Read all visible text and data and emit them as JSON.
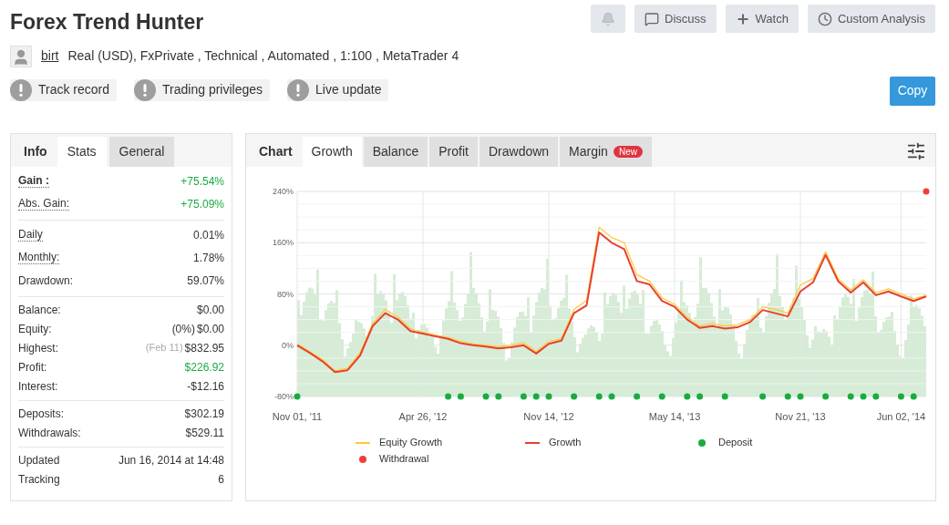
{
  "header": {
    "title": "Forex Trend Hunter",
    "actions": [
      {
        "kind": "bell"
      },
      {
        "kind": "discuss",
        "label": "Discuss"
      },
      {
        "kind": "watch",
        "label": "Watch"
      },
      {
        "kind": "clock",
        "label": "Custom Analysis"
      }
    ]
  },
  "account": {
    "author": "birt",
    "details": "Real (USD), FxPrivate , Technical , Automated , 1:100 , MetaTrader 4"
  },
  "badges": [
    "Track record",
    "Trading privileges",
    "Live update"
  ],
  "copy_button": "Copy",
  "stats_panel": {
    "title": "Info",
    "tabs": [
      {
        "label": "Stats",
        "selected": true
      },
      {
        "label": "General",
        "selected": false
      }
    ],
    "groups": [
      {
        "rows": [
          {
            "label": "Gain :",
            "value": "+75.54%",
            "bold": true,
            "dotted": true,
            "positive": true
          },
          {
            "label": "Abs. Gain:",
            "value": "+75.09%",
            "bold": false,
            "dotted": true,
            "positive": true
          }
        ]
      },
      {
        "rows": [
          {
            "label": "Daily",
            "value": "0.01%",
            "bold": false,
            "dotted": true,
            "positive": false
          },
          {
            "label": "Monthly:",
            "value": "1.78%",
            "bold": false,
            "dotted": true,
            "positive": false
          },
          {
            "label": "Drawdown:",
            "value": "59.07%",
            "bold": false,
            "dotted": false,
            "positive": false
          }
        ]
      },
      {
        "rows": [
          {
            "label": "Balance:",
            "value": "$0.00",
            "bold": false,
            "dotted": false,
            "positive": false
          },
          {
            "label": "Equity:",
            "note": "(0%)",
            "note_muted": false,
            "value": "$0.00",
            "bold": false,
            "dotted": false,
            "positive": false
          },
          {
            "label": "Highest:",
            "note": "(Feb 11)",
            "note_muted": true,
            "value": "$832.95",
            "bold": false,
            "dotted": false,
            "positive": false
          },
          {
            "label": "Profit:",
            "value": "$226.92",
            "bold": false,
            "dotted": false,
            "positive": true
          },
          {
            "label": "Interest:",
            "value": "-$12.16",
            "bold": false,
            "dotted": false,
            "positive": false
          }
        ]
      },
      {
        "rows": [
          {
            "label": "Deposits:",
            "value": "$302.19",
            "bold": false,
            "dotted": false,
            "positive": false
          },
          {
            "label": "Withdrawals:",
            "value": "$529.11",
            "bold": false,
            "dotted": false,
            "positive": false
          }
        ]
      },
      {
        "rows": [
          {
            "label": "Updated",
            "value": "Jun 16, 2014 at 14:48",
            "bold": false,
            "dotted": false,
            "positive": false
          },
          {
            "label": "Tracking",
            "value": "6",
            "bold": false,
            "dotted": false,
            "positive": false
          }
        ]
      }
    ]
  },
  "chart_panel": {
    "title": "Chart",
    "tabs": [
      {
        "label": "Growth",
        "selected": true
      },
      {
        "label": "Balance",
        "selected": false
      },
      {
        "label": "Profit",
        "selected": false
      },
      {
        "label": "Drawdown",
        "selected": false
      },
      {
        "label": "Margin",
        "selected": false,
        "badge": "New"
      }
    ],
    "chart_data": {
      "type": "line",
      "categories": [
        "Nov 01, '11",
        null,
        null,
        null,
        null,
        null,
        null,
        null,
        null,
        null,
        "Apr 26, '12",
        null,
        null,
        null,
        null,
        null,
        null,
        null,
        null,
        null,
        "Nov 14, '12",
        null,
        null,
        null,
        null,
        null,
        null,
        null,
        null,
        null,
        "May 14, '13",
        null,
        null,
        null,
        null,
        null,
        null,
        null,
        null,
        null,
        "Nov 21, '13",
        null,
        null,
        null,
        null,
        null,
        null,
        null,
        "Jun 02, '14",
        null,
        null
      ],
      "ylim": [
        -80,
        240
      ],
      "grid": true,
      "yticks": [
        {
          "value": 240,
          "label": "240%"
        },
        {
          "value": 160,
          "label": "160%"
        },
        {
          "value": 80,
          "label": "80%"
        },
        {
          "value": 0,
          "label": "0%"
        },
        {
          "value": -80,
          "label": "-80%"
        }
      ],
      "series": [
        {
          "name": "Equity Growth",
          "color": "#ffc933",
          "values": [
            2,
            -10,
            -22,
            -40,
            -36,
            -12,
            34,
            56,
            44,
            26,
            20,
            16,
            12,
            6,
            2,
            0,
            -2,
            0,
            4,
            -10,
            6,
            10,
            56,
            70,
            184,
            168,
            160,
            110,
            100,
            74,
            64,
            44,
            30,
            34,
            30,
            32,
            40,
            60,
            56,
            50,
            94,
            104,
            146,
            104,
            86,
            102,
            82,
            88,
            80,
            72,
            78
          ]
        },
        {
          "name": "Growth",
          "color": "#e8402f",
          "values": [
            0,
            -12,
            -25,
            -42,
            -39,
            -16,
            30,
            50,
            40,
            22,
            18,
            14,
            10,
            3,
            0,
            -2,
            -5,
            -3,
            0,
            -13,
            2,
            7,
            50,
            62,
            176,
            160,
            150,
            100,
            95,
            69,
            60,
            40,
            27,
            30,
            26,
            28,
            36,
            55,
            50,
            45,
            84,
            98,
            141,
            100,
            82,
            98,
            78,
            84,
            76,
            69,
            76
          ]
        },
        {
          "name": "Deposit",
          "type": "scatter",
          "color": "#1aab40",
          "values": [
            -80,
            null,
            null,
            null,
            null,
            null,
            null,
            null,
            null,
            null,
            null,
            null,
            -80,
            -80,
            null,
            -80,
            -80,
            null,
            -80,
            -80,
            -80,
            null,
            -80,
            null,
            -80,
            -80,
            null,
            -80,
            null,
            -80,
            null,
            -80,
            -80,
            null,
            -80,
            null,
            null,
            -80,
            null,
            -80,
            -80,
            null,
            -80,
            null,
            -80,
            -80,
            -80,
            null,
            -80,
            -80,
            null
          ]
        },
        {
          "name": "Withdrawal",
          "type": "scatter",
          "color": "#ef4036",
          "values": [
            null,
            null,
            null,
            null,
            null,
            null,
            null,
            null,
            null,
            null,
            null,
            null,
            null,
            null,
            null,
            null,
            null,
            null,
            null,
            null,
            null,
            null,
            null,
            null,
            null,
            null,
            null,
            null,
            null,
            null,
            null,
            null,
            null,
            null,
            null,
            null,
            null,
            null,
            null,
            null,
            null,
            null,
            null,
            null,
            null,
            null,
            null,
            null,
            null,
            null,
            240
          ]
        }
      ]
    }
  }
}
